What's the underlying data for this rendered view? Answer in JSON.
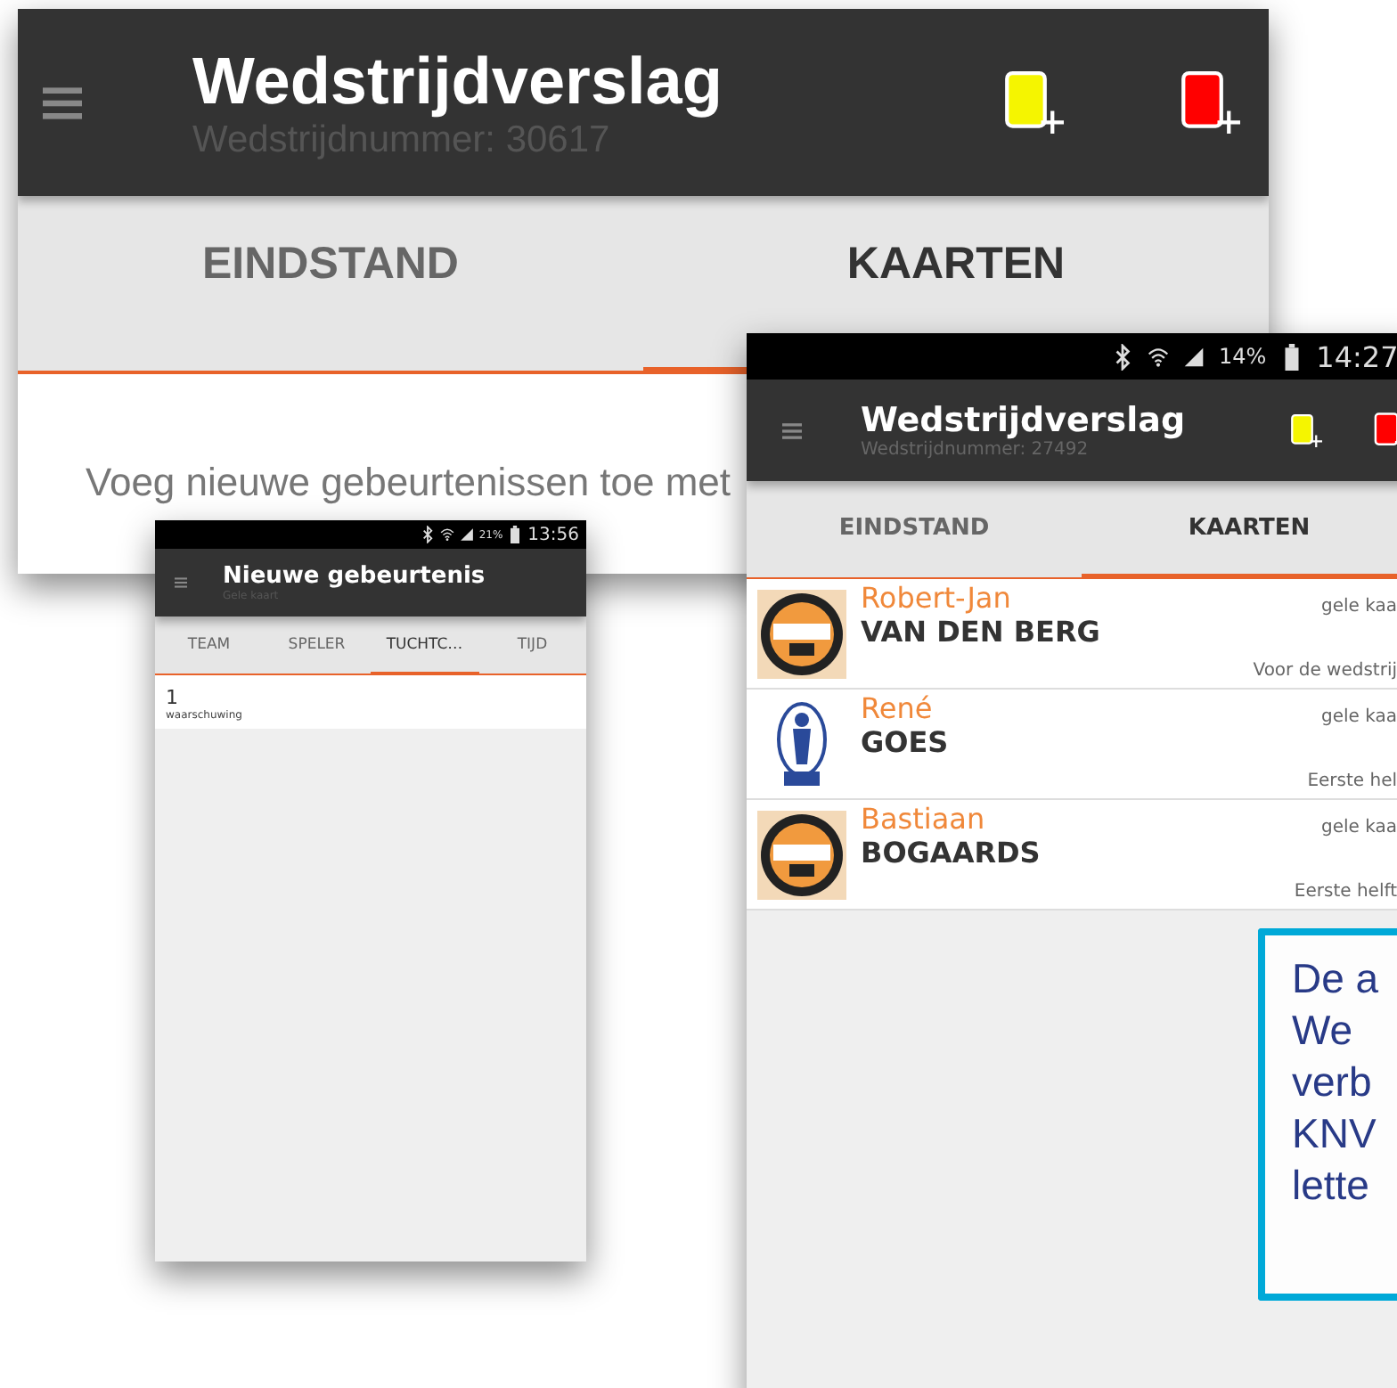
{
  "screens": [
    {
      "kind": "report",
      "title": "Wedstrijdverslag",
      "subtitle": "Wedstrijdnummer: 30617",
      "tabs": [
        {
          "label": "EINDSTAND",
          "selected": false
        },
        {
          "label": "KAARTEN",
          "selected": true
        }
      ],
      "message": "Voeg nieuwe gebeurtenissen toe met"
    },
    {
      "kind": "event",
      "status": {
        "battery": "21%",
        "time": "13:56"
      },
      "title": "Nieuwe gebeurtenis",
      "subtitle": "Gele kaart",
      "tabs": [
        {
          "label": "TEAM",
          "selected": false
        },
        {
          "label": "SPELER",
          "selected": false
        },
        {
          "label": "TUCHTC…",
          "selected": true
        },
        {
          "label": "TIJD",
          "selected": false
        }
      ],
      "items": [
        {
          "number": "1",
          "label": "waarschuwing"
        }
      ]
    },
    {
      "kind": "report",
      "status": {
        "battery": "14%",
        "time": "14:27"
      },
      "title": "Wedstrijdverslag",
      "subtitle": "Wedstrijdnummer: 27492",
      "tabs": [
        {
          "label": "EINDSTAND",
          "selected": false
        },
        {
          "label": "KAARTEN",
          "selected": true
        }
      ],
      "cards": [
        {
          "kind": "round-badge",
          "first_name": "Robert-Jan",
          "last_name": "VAN DEN BERG",
          "card": "gele kaa",
          "moment": "Voor de wedstrij"
        },
        {
          "kind": "figure-crest",
          "first_name": "René",
          "last_name": "GOES",
          "card": "gele kaa",
          "moment": "Eerste hel"
        },
        {
          "kind": "round-badge",
          "first_name": "Bastiaan",
          "last_name": "BOGAARDS",
          "card": "gele kaa",
          "moment": "Eerste helft"
        }
      ],
      "note": {
        "lines": [
          "De a",
          "We",
          "verb",
          "KNV",
          "lette"
        ]
      }
    }
  ]
}
